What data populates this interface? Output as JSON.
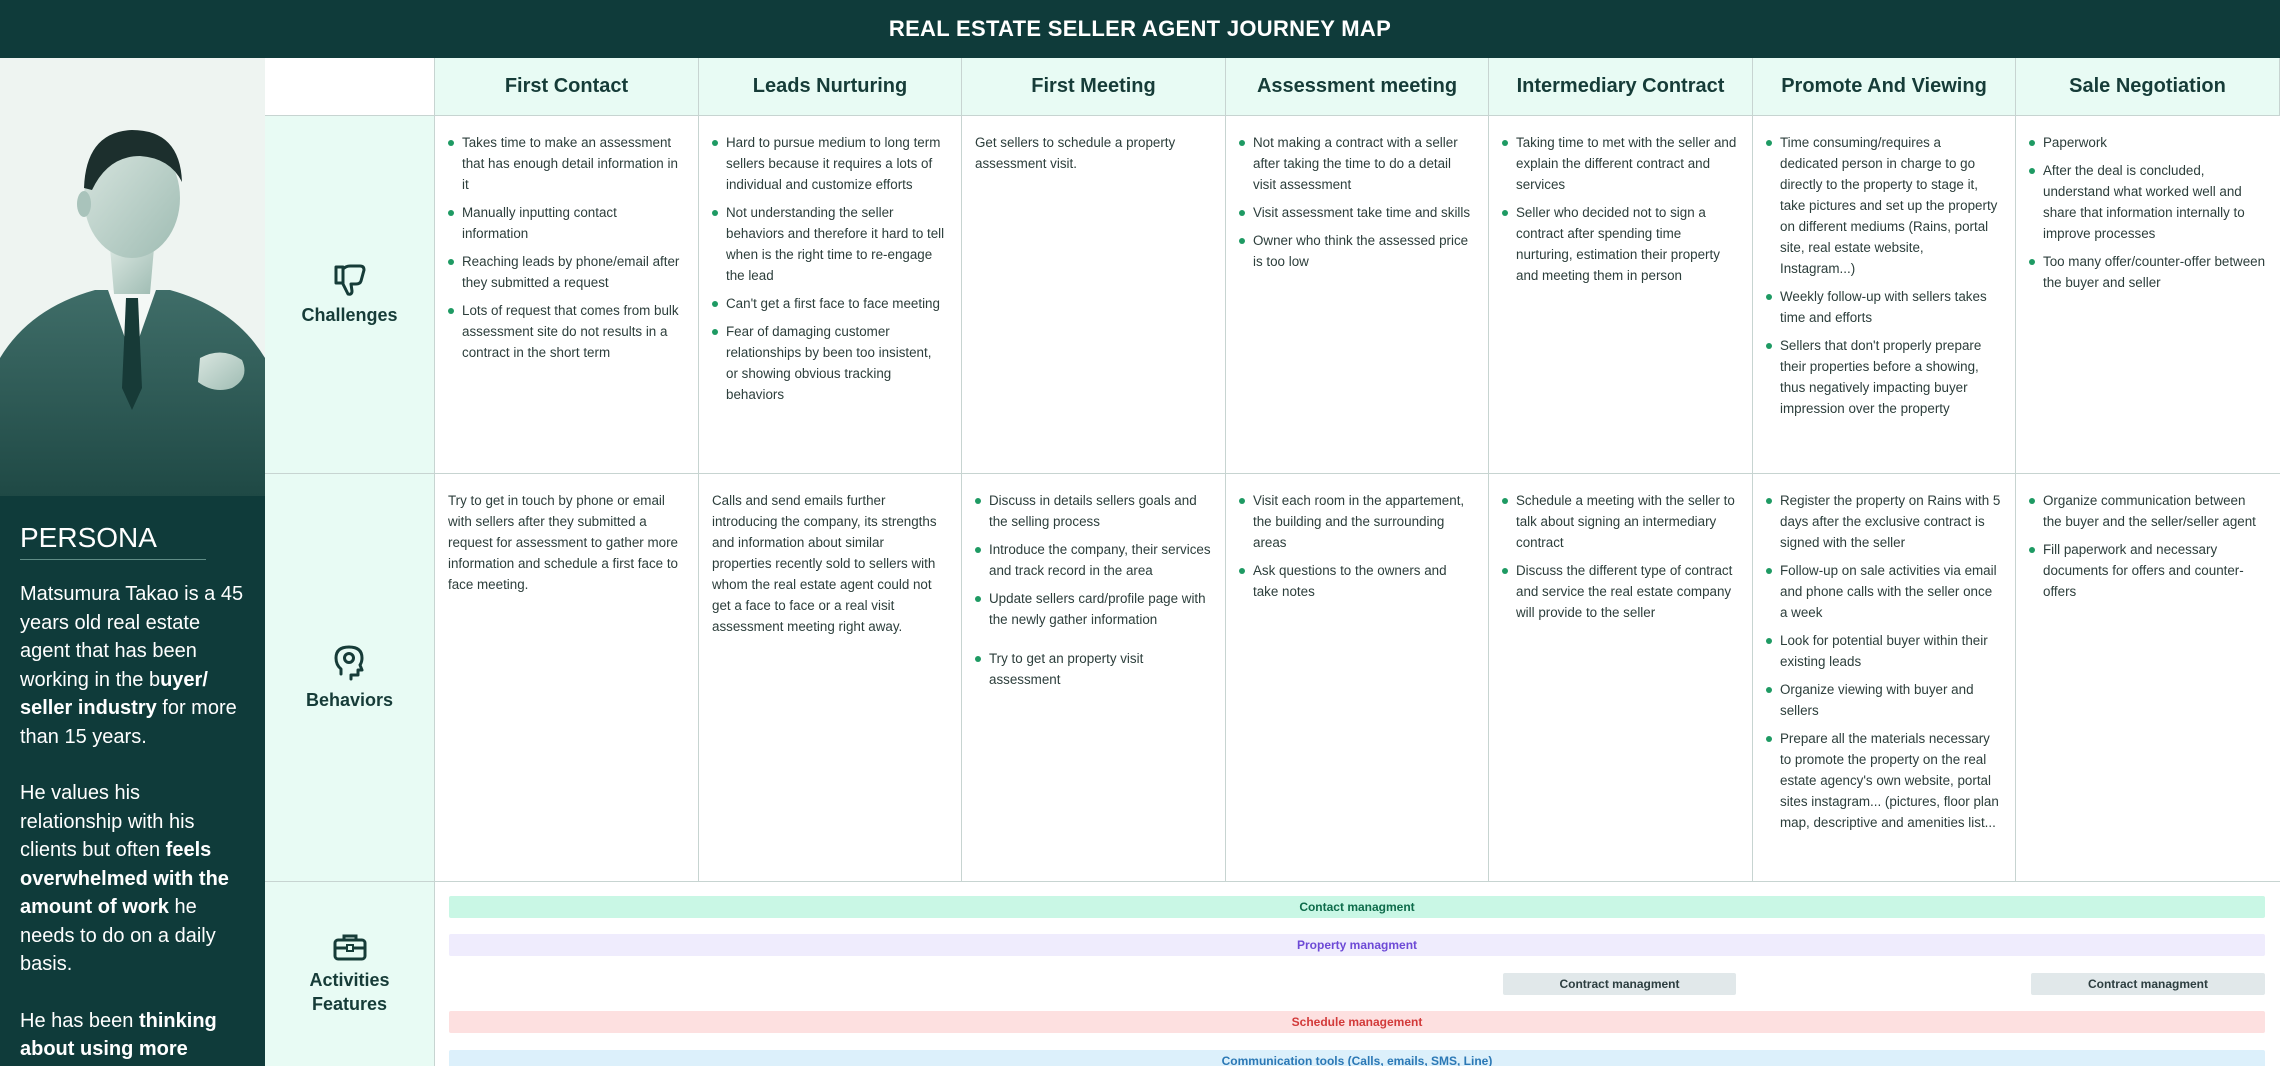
{
  "header": {
    "title": "REAL ESTATE SELLER AGENT JOURNEY MAP"
  },
  "persona": {
    "title": "PERSONA",
    "p1_a": "Matsumura Takao is a 45 years old real estate agent that has been working in the b",
    "p1_b": "uyer/ seller industry",
    "p1_c": " for more than 15 years.",
    "p2_a": "He values his relationship with his clients but often ",
    "p2_b": "feels overwhelmed with the amount of work",
    "p2_c": " he needs to do on a daily basis.",
    "p3_a": "He has been ",
    "p3_b": "thinking about using more"
  },
  "columns": [
    "First Contact",
    "Leads Nurturing",
    "First Meeting",
    "Assessment meeting",
    "Intermediary Contract",
    "Promote And Viewing",
    "Sale Negotiation"
  ],
  "rows": {
    "challenges": {
      "label": "Challenges",
      "icon": "thumbs-down-icon"
    },
    "behaviors": {
      "label": "Behaviors",
      "icon": "head-gear-icon"
    },
    "features": {
      "label1": "Activities",
      "label2": "Features",
      "icon": "briefcase-icon"
    }
  },
  "challenges": {
    "c0": [
      "Takes time to make an assessment that has enough detail information in it",
      "Manually inputting contact information",
      "Reaching leads by phone/email after they submitted a request",
      "Lots of request that comes from bulk assessment site do not results in a contract in the short term"
    ],
    "c1": [
      "Hard to pursue medium to long term sellers because it requires a lots of individual and customize efforts",
      "Not understanding the seller behaviors and therefore it hard to tell when is the right time to re-engage the lead",
      "Can't get a first face to face meeting",
      "Fear of damaging customer relationships by been too insistent, or showing obvious tracking behaviors"
    ],
    "c2_text": "Get sellers to schedule a property assessment visit.",
    "c3": [
      "Not making a contract with a seller after taking the time to do a detail visit assessment",
      "Visit assessment take time and skills",
      "Owner who think the assessed price is too low"
    ],
    "c4": [
      "Taking time to met with the seller and explain the different contract and services",
      "Seller who decided not to sign a contract after spending time nurturing, estimation their property and meeting them in person"
    ],
    "c5": [
      "Time consuming/requires a dedicated person in charge to go directly to the property to stage it, take pictures and set up the property on different mediums (Rains, portal site, real estate website, Instagram...)",
      "Weekly follow-up with sellers takes time and efforts",
      "Sellers that don't properly prepare their properties before a showing, thus negatively impacting buyer impression over the property"
    ],
    "c6": [
      "Paperwork",
      "After the deal is concluded, understand what worked well and share that information internally to improve processes",
      "Too many offer/counter-offer between the buyer and seller"
    ]
  },
  "behaviors": {
    "b0_text": "Try to get in touch by phone or email with sellers after they submitted a request for assessment to gather more information and schedule a first face to face meeting.",
    "b1_text": "Calls and send emails further introducing the company, its strengths and information about similar properties recently sold to sellers with whom the real estate agent could not get a face to face or a real visit assessment meeting right away.",
    "b2": [
      "Discuss in details sellers goals and the selling process",
      "Introduce the company, their services and track record in the area",
      "Update sellers card/profile page with the newly gather information",
      "Try to get an property visit assessment"
    ],
    "b3": [
      "Visit each room in the appartement, the building and the surrounding areas",
      "Ask questions to the owners and take notes"
    ],
    "b4": [
      "Schedule a meeting with the seller to talk about signing an intermediary contract",
      "Discuss the different type of contract and service the real estate company will provide to the seller"
    ],
    "b5": [
      "Register the property on Rains with 5 days after the exclusive contract is signed with the seller",
      "Follow-up on sale activities via email and phone calls with the seller once a week",
      "Look for potential buyer within their existing leads",
      "Organize viewing with buyer and sellers",
      "Prepare all the materials necessary to promote the property on the real estate agency's own website, portal sites instagram... (pictures, floor plan map, descriptive and amenities list..."
    ],
    "b6": [
      "Organize communication between the buyer and the seller/seller agent",
      "Fill paperwork and necessary documents for offers and counter-offers"
    ]
  },
  "features": {
    "contact": "Contact managment",
    "property": "Property managment",
    "contract1": "Contract managment",
    "contract2": "Contract managment",
    "schedule": "Schedule management",
    "communication": "Communication tools (Calls, emails, SMS, Line)"
  },
  "colors": {
    "dark_teal": "#0f3b3a",
    "mint": "#e8fbf4",
    "bullet": "#1e9a63",
    "contact_bar": "#c9f7e5",
    "property_bar": "#efecfd",
    "contract_bar": "#e1e8ea",
    "schedule_bar": "#fde0e0",
    "communication_bar": "#dcf0fb"
  }
}
